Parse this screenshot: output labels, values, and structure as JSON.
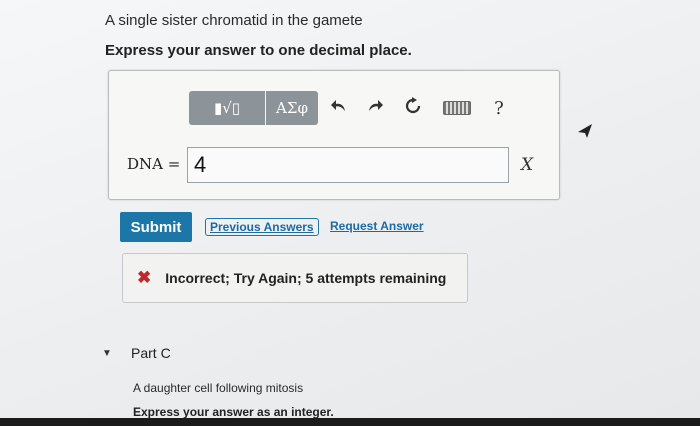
{
  "question": "A single sister chromatid in the gamete",
  "instruction": "Express your answer to one decimal place.",
  "toolbar": {
    "templates_label": "▮√▯",
    "greek_label": "ΑΣφ",
    "undo_icon": "undo-icon",
    "redo_icon": "redo-icon",
    "reset_icon": "reset-icon",
    "keyboard_icon": "keyboard-icon",
    "help_label": "?"
  },
  "answer": {
    "variable_label": "DNA =",
    "value": "4",
    "units_label": "X"
  },
  "buttons": {
    "submit_label": "Submit",
    "previous_answers_label": "Previous Answers",
    "request_answer_label": "Request Answer"
  },
  "feedback": {
    "icon": "✖",
    "text": "Incorrect; Try Again; 5 attempts remaining"
  },
  "part_c": {
    "toggle": "▼",
    "title": "Part C",
    "question": "A daughter cell following mitosis",
    "instruction": "Express your answer as an integer."
  },
  "colors": {
    "submit_bg": "#1c76a8",
    "link": "#1c6aa3",
    "error": "#c0282d",
    "toolbar_btn": "#8d9499"
  }
}
